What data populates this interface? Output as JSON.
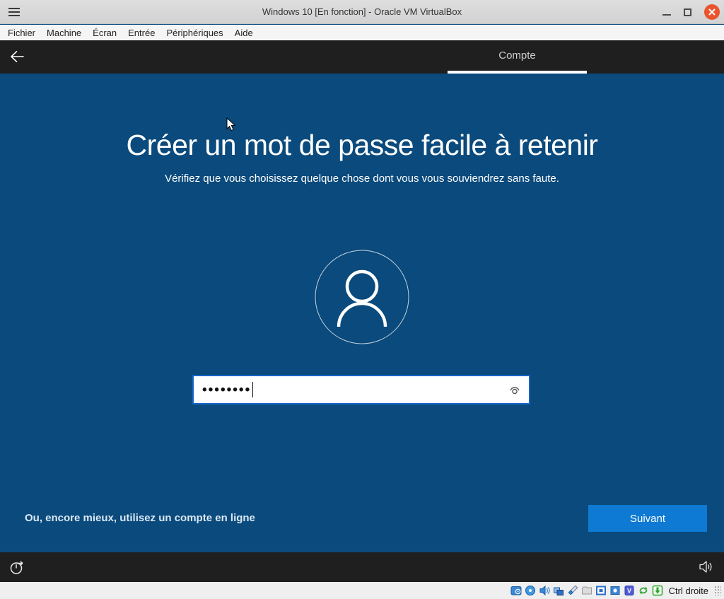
{
  "window": {
    "title": "Windows 10 [En fonction] - Oracle VM VirtualBox"
  },
  "menubar": {
    "items": [
      "Fichier",
      "Machine",
      "Écran",
      "Entrée",
      "Périphériques",
      "Aide"
    ]
  },
  "oobe": {
    "header": {
      "tab_label": "Compte"
    },
    "heading": "Créer un mot de passe facile à retenir",
    "subheading": "Vérifiez que vous choisissez quelque chose dont vous vous souviendrez sans faute.",
    "password_field": {
      "masked_value": "••••••••"
    },
    "online_account_link": "Ou, encore mieux, utilisez un compte en ligne",
    "next_button_label": "Suivant"
  },
  "statusbar": {
    "host_key_label": "Ctrl droite",
    "icons": [
      "hard-disks-icon",
      "optical-drives-icon",
      "audio-icon",
      "network-icon",
      "usb-icon",
      "shared-folders-icon",
      "display-icon",
      "recording-icon",
      "features-icon",
      "mouse-integration-icon",
      "keyboard-icon"
    ]
  },
  "colors": {
    "oobe_background": "#0a4a7c",
    "oobe_bar": "#1f1f1f",
    "accent_blue": "#0e7ad3",
    "input_focus_border": "#1565c5",
    "close_button": "#e9542d"
  }
}
